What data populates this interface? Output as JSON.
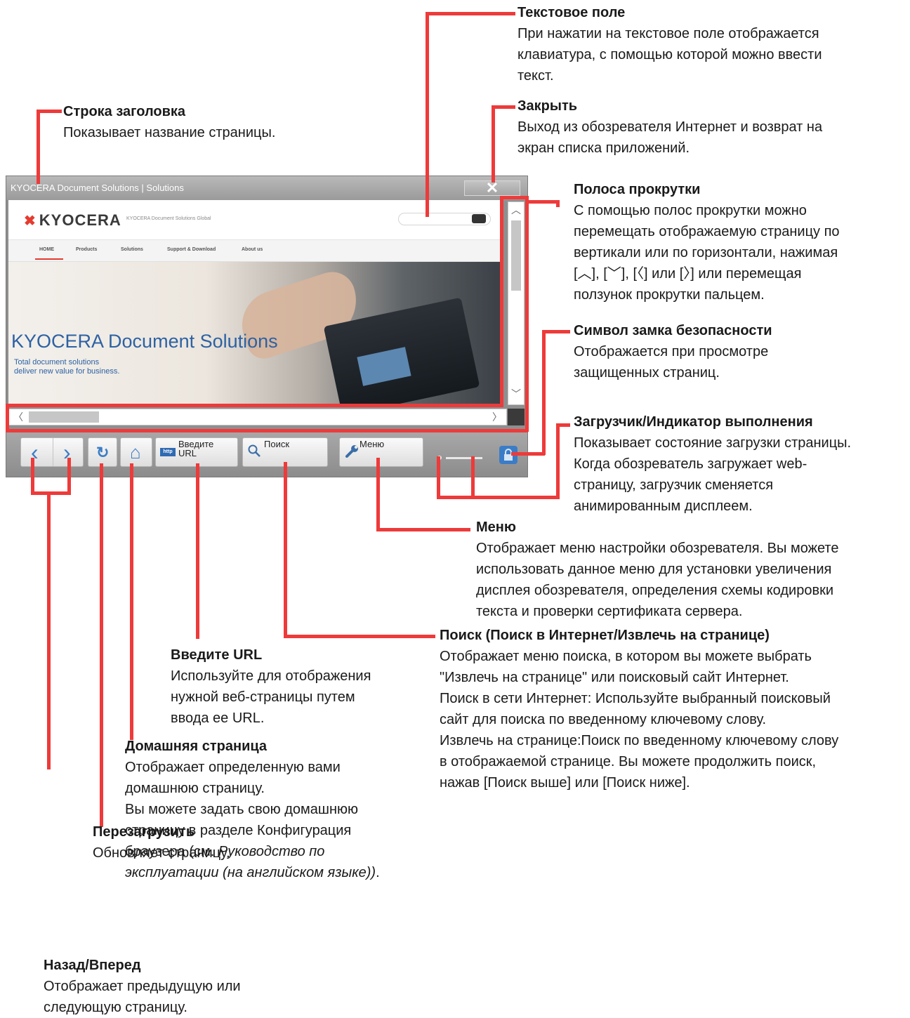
{
  "browser": {
    "title": "KYOCERA Document Solutions | Solutions",
    "close_glyph": "✕",
    "site": {
      "logo": "KYOCERA",
      "logo_sub": "KYOCERA Document Solutions  Global",
      "nav": [
        "HOME",
        "Products",
        "Solutions",
        "Support & Download",
        "About us"
      ],
      "hero_title": "KYOCERA Document Solutions",
      "hero_sub1": "Total document solutions",
      "hero_sub2": "deliver new value for business."
    },
    "toolbar": {
      "back_glyph": "‹",
      "forward_glyph": "›",
      "reload_glyph": "↻",
      "home_glyph": "⌂",
      "url_icon": "http",
      "url_label1": "Введите",
      "url_label2": "URL",
      "search_label": "Поиск",
      "menu_label": "Меню"
    },
    "icons": [
      "close-icon",
      "search-icon",
      "back-icon",
      "forward-icon",
      "reload-icon",
      "home-icon",
      "url-icon",
      "wrench-icon",
      "lock-icon"
    ]
  },
  "annotations": {
    "text_field": {
      "title": "Текстовое поле",
      "lines": [
        "При нажатии на текстовое поле отображается",
        "клавиатура, с помощью которой можно ввести",
        "текст."
      ]
    },
    "close": {
      "title": "Закрыть",
      "lines": [
        "Выход из обозревателя Интернет и возврат на",
        "экран списка приложений."
      ]
    },
    "title_bar": {
      "title": "Строка заголовка",
      "lines": [
        "Показывает название страницы."
      ]
    },
    "scrollbar": {
      "title": "Полоса прокрутки",
      "lines": [
        "С помощью полос прокрутки можно",
        "перемещать отображаемую страницу по",
        "вертикали или по горизонтали, нажимая",
        "[︿], [﹀], [〈] или [〉] или перемещая",
        "ползунок прокрутки пальцем."
      ]
    },
    "lock": {
      "title": "Символ замка безопасности",
      "lines": [
        "Отображается при просмотре",
        "защищенных страниц."
      ]
    },
    "loader": {
      "title": "Загрузчик/Индикатор выполнения",
      "lines": [
        "Показывает состояние загрузки страницы.",
        "Когда обозреватель загружает web-",
        "страницу, загрузчик сменяется",
        "анимированным дисплеем."
      ]
    },
    "menu": {
      "title": "Меню",
      "lines": [
        "Отображает меню настройки обозревателя. Вы можете",
        "использовать данное меню для установки увеличения",
        "дисплея обозревателя, определения схемы кодировки",
        "текста и проверки сертификата сервера."
      ]
    },
    "search": {
      "title": "Поиск (Поиск в Интернет/Извлечь на странице)",
      "lines": [
        "Отображает меню поиска, в котором вы можете выбрать",
        "\"Извлечь на странице\" или поисковый сайт Интернет.",
        "Поиск в сети Интернет: Используйте выбранный поисковый",
        "сайт для поиска по введенному ключевому слову.",
        "Извлечь на странице:Поиск по введенному ключевому слову",
        "в отображаемой странице. Вы можете продолжить поиск,",
        "нажав [Поиск выше] или [Поиск ниже]."
      ]
    },
    "url": {
      "title": "Введите URL",
      "lines": [
        "Используйте для отображения",
        "нужной веб-страницы путем",
        "ввода ее URL."
      ]
    },
    "home": {
      "title": "Домашняя страница",
      "lines": [
        "Отображает определенную вами",
        "домашнюю страницу.",
        "Вы можете задать свою домашнюю",
        "страницу в разделе Конфигурация"
      ],
      "line5_pre": "браузера (см. ",
      "line5_em": "Руководство по",
      "line6_em": "эксплуатации (на английском языке))",
      "line6_post": "."
    },
    "reload": {
      "title": "Перезагрузить",
      "lines": [
        "Обновляет страницу."
      ]
    },
    "back_forward": {
      "title": "Назад/Вперед",
      "lines": [
        "Отображает предыдущую или",
        "следующую страницу."
      ]
    }
  }
}
